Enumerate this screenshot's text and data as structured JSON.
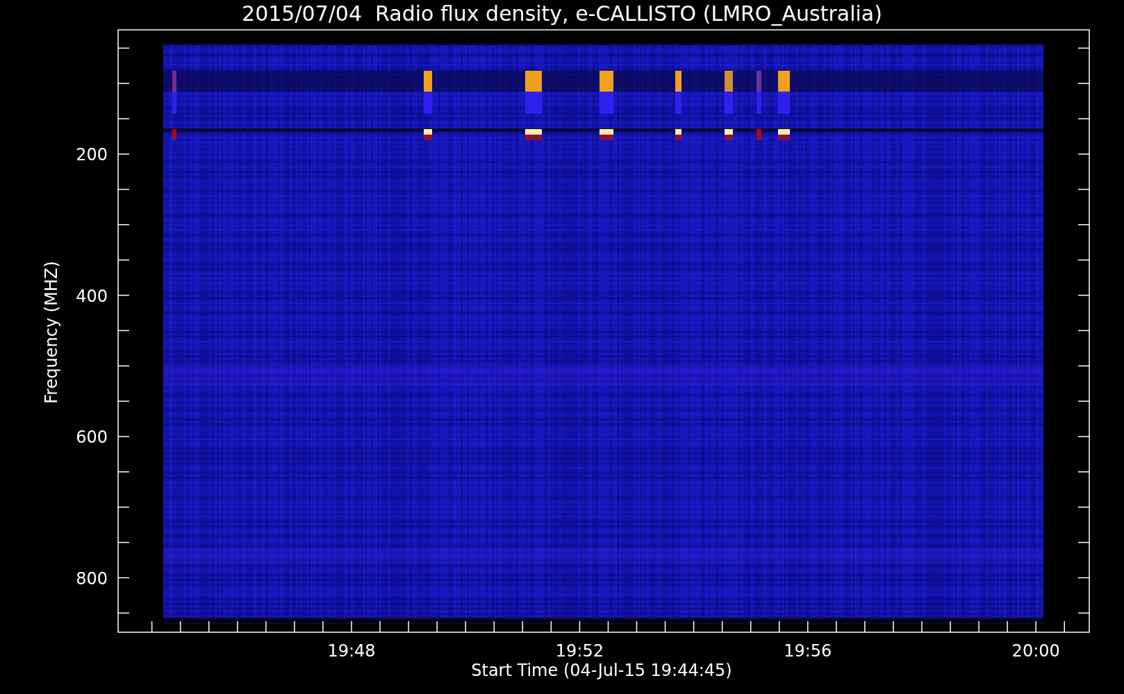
{
  "title": "2015/07/04  Radio flux density, e-CALLISTO (LMRO_Australia)",
  "y_axis": {
    "label": "Frequency (MHZ)",
    "ticks": [
      "200",
      "400",
      "600",
      "800"
    ]
  },
  "x_axis": {
    "label": "Start Time (04-Jul-15 19:44:45)",
    "ticks": [
      "19:48",
      "19:52",
      "19:56",
      "20:00"
    ]
  }
}
